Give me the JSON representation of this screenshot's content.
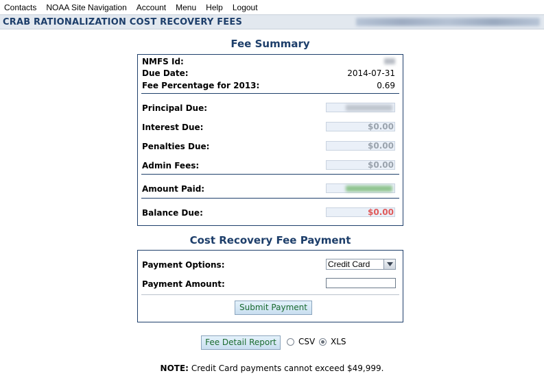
{
  "menu": [
    "Contacts",
    "NOAA Site Navigation",
    "Account",
    "Menu",
    "Help",
    "Logout"
  ],
  "page_title": "CRAB RATIONALIZATION COST RECOVERY FEES",
  "fee_summary": {
    "title": "Fee Summary",
    "nmfs_id_label": "NMFS Id:",
    "due_date_label": "Due Date:",
    "due_date": "2014-07-31",
    "fee_pct_label": "Fee Percentage for 2013:",
    "fee_pct": "0.69",
    "principal_label": "Principal Due:",
    "interest_label": "Interest Due:",
    "interest": "$0.00",
    "penalties_label": "Penalties Due:",
    "penalties": "$0.00",
    "admin_label": "Admin Fees:",
    "admin": "$0.00",
    "amount_paid_label": "Amount Paid:",
    "balance_label": "Balance Due:",
    "balance": "$0.00"
  },
  "payment": {
    "title": "Cost Recovery Fee Payment",
    "options_label": "Payment Options:",
    "selected_option": "Credit Card",
    "amount_label": "Payment Amount:",
    "amount_value": "",
    "submit_label": "Submit Payment"
  },
  "report": {
    "button_label": "Fee Detail Report",
    "csv_label": "CSV",
    "xls_label": "XLS",
    "selected_format": "XLS"
  },
  "note": {
    "bold": "NOTE:",
    "text": "Credit Card payments cannot exceed $49,999."
  },
  "colors": {
    "navy": "#1d3e6a",
    "balance_red": "#e05a5a",
    "button_text": "#1a6b2f"
  }
}
